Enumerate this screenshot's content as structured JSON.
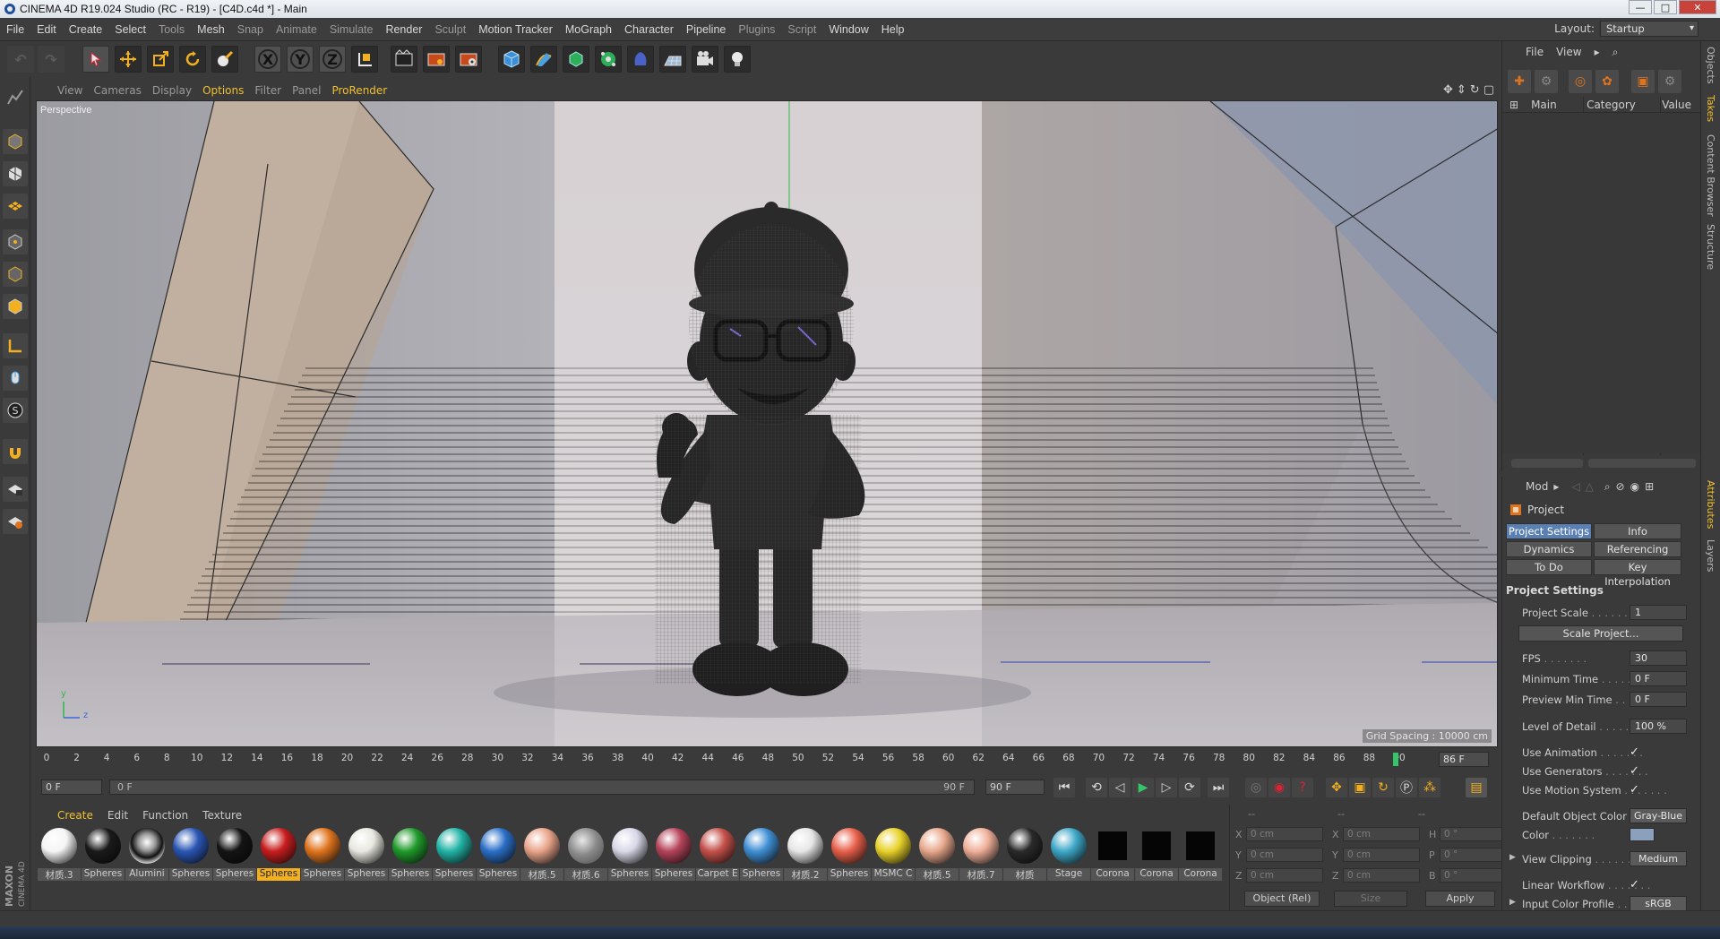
{
  "window": {
    "title": "CINEMA 4D R19.024 Studio (RC - R19) - [C4D.c4d *] - Main",
    "minimize": "—",
    "maximize": "□",
    "close": "✕"
  },
  "menu": [
    "File",
    "Edit",
    "Create",
    "Select",
    "Tools",
    "Mesh",
    "Snap",
    "Animate",
    "Simulate",
    "Render",
    "Sculpt",
    "Motion Tracker",
    "MoGraph",
    "Character",
    "Pipeline",
    "Plugins",
    "Script",
    "Window",
    "Help"
  ],
  "layout": {
    "label": "Layout:",
    "value": "Startup"
  },
  "toolbar_axes": [
    "X",
    "Y",
    "Z"
  ],
  "viewport": {
    "menu": [
      "View",
      "Cameras",
      "Display",
      "Options",
      "Filter",
      "Panel",
      "ProRender"
    ],
    "active_menu": "Options",
    "label": "Perspective",
    "grid_spacing": "Grid Spacing : 10000 cm",
    "axis_y": "y",
    "axis_z": "z"
  },
  "timeline": {
    "ticks": [
      "0",
      "2",
      "4",
      "6",
      "8",
      "10",
      "12",
      "14",
      "16",
      "18",
      "20",
      "22",
      "24",
      "26",
      "28",
      "30",
      "32",
      "34",
      "36",
      "38",
      "40",
      "42",
      "44",
      "46",
      "48",
      "50",
      "52",
      "54",
      "56",
      "58",
      "60",
      "62",
      "64",
      "66",
      "68",
      "70",
      "72",
      "74",
      "76",
      "78",
      "80",
      "82",
      "84",
      "86",
      "88",
      "90"
    ],
    "current_frame": "86 F",
    "start_field": "0 F",
    "range_start": "0 F",
    "range_end": "90 F",
    "end_field": "90 F"
  },
  "materials_manager": {
    "menu": [
      "Create",
      "Edit",
      "Function",
      "Texture"
    ],
    "active_menu": "Create",
    "items": [
      {
        "name": "材质.3",
        "color": "#f4f4f4",
        "shape": "ball"
      },
      {
        "name": "Spheres",
        "color": "#1a1a1a",
        "shape": "ball"
      },
      {
        "name": "Alumini",
        "color": "#9a9a9a",
        "shape": "chrome"
      },
      {
        "name": "Spheres",
        "color": "#2a56b5",
        "shape": "ball"
      },
      {
        "name": "Spheres",
        "color": "#141414",
        "shape": "ball"
      },
      {
        "name": "Spheres",
        "color": "#c81d1d",
        "shape": "ball",
        "selected": true
      },
      {
        "name": "Spheres",
        "color": "#e0741e",
        "shape": "ball"
      },
      {
        "name": "Spheres",
        "color": "#e8e8e0",
        "shape": "ball"
      },
      {
        "name": "Spheres",
        "color": "#1f9a2a",
        "shape": "ball"
      },
      {
        "name": "Spheres",
        "color": "#22b3a6",
        "shape": "ball"
      },
      {
        "name": "Spheres",
        "color": "#2b6fc8",
        "shape": "ball"
      },
      {
        "name": "材质.5",
        "color": "#e9a48a",
        "shape": "ball"
      },
      {
        "name": "材质.6",
        "color": "#9a9a9a",
        "shape": "glass"
      },
      {
        "name": "Spheres",
        "color": "#d8d8e8",
        "shape": "ball"
      },
      {
        "name": "Spheres",
        "color": "#b5435a",
        "shape": "ball"
      },
      {
        "name": "Carpet E",
        "color": "#c5504a",
        "shape": "ball"
      },
      {
        "name": "Spheres",
        "color": "#3f8fd4",
        "shape": "ball"
      },
      {
        "name": "材质.2",
        "color": "#e6e6e6",
        "shape": "ball"
      },
      {
        "name": "Spheres",
        "color": "#e8604a",
        "shape": "ball"
      },
      {
        "name": "MSMC C",
        "color": "#e8d22a",
        "shape": "ball"
      },
      {
        "name": "材质.5",
        "color": "#e8a88c",
        "shape": "ball"
      },
      {
        "name": "材质.7",
        "color": "#f0b09a",
        "shape": "ball"
      },
      {
        "name": "材质",
        "color": "#2a2a2a",
        "shape": "ball"
      },
      {
        "name": "Stage",
        "color": "#3ea8c8",
        "shape": "ball"
      },
      {
        "name": "Corona",
        "color": "#050505",
        "shape": "square"
      },
      {
        "name": "Corona",
        "color": "#050505",
        "shape": "square"
      },
      {
        "name": "Corona",
        "color": "#050505",
        "shape": "square"
      }
    ]
  },
  "coordinates": {
    "header": [
      "--",
      "--",
      "--"
    ],
    "rows": [
      {
        "a1": "X",
        "v1": "0 cm",
        "a2": "X",
        "v2": "0 cm",
        "a3": "H",
        "v3": "0 °"
      },
      {
        "a1": "Y",
        "v1": "0 cm",
        "a2": "Y",
        "v2": "0 cm",
        "a3": "P",
        "v3": "0 °"
      },
      {
        "a1": "Z",
        "v1": "0 cm",
        "a2": "Z",
        "v2": "0 cm",
        "a3": "B",
        "v3": "0 °"
      }
    ],
    "mode": "Object (Rel)",
    "size_mode": "Size",
    "apply": "Apply"
  },
  "objects_panel": {
    "menu": [
      "File",
      "View"
    ],
    "columns": [
      "Main",
      "Category",
      "Value"
    ]
  },
  "attributes": {
    "menu": "Mod",
    "title": "Project",
    "tabs": [
      "Project Settings",
      "Info",
      "Dynamics",
      "Referencing",
      "To Do",
      "Key Interpolation"
    ],
    "active_tab": "Project Settings",
    "section": "Project Settings",
    "project_scale_label": "Project Scale",
    "project_scale_value": "1",
    "scale_project_button": "Scale Project...",
    "fps_label": "FPS",
    "fps_value": "30",
    "min_time_label": "Minimum Time",
    "min_time_value": "0 F",
    "preview_min_label": "Preview Min Time",
    "preview_min_value": "0 F",
    "lod_label": "Level of Detail",
    "lod_value": "100 %",
    "use_animation_label": "Use Animation",
    "use_generators_label": "Use Generators",
    "use_motion_label": "Use Motion System",
    "check": "✓",
    "default_color_label": "Default Object Color",
    "default_color_value": "Gray-Blue",
    "color_label": "Color",
    "view_clipping_label": "View Clipping",
    "view_clipping_value": "Medium",
    "linear_workflow_label": "Linear Workflow",
    "input_color_label": "Input Color Profile",
    "input_color_value": "sRGB"
  },
  "side_tabs": [
    "Objects",
    "Takes",
    "Content Browser",
    "Structure",
    "Attributes",
    "Layers"
  ],
  "logo": {
    "line1": "MAXON",
    "line2": "CINEMA 4D"
  },
  "colors": {
    "accent": "#f0c030",
    "selection_blue": "#5a7fb3",
    "panel_bg": "#3a3a3a"
  }
}
